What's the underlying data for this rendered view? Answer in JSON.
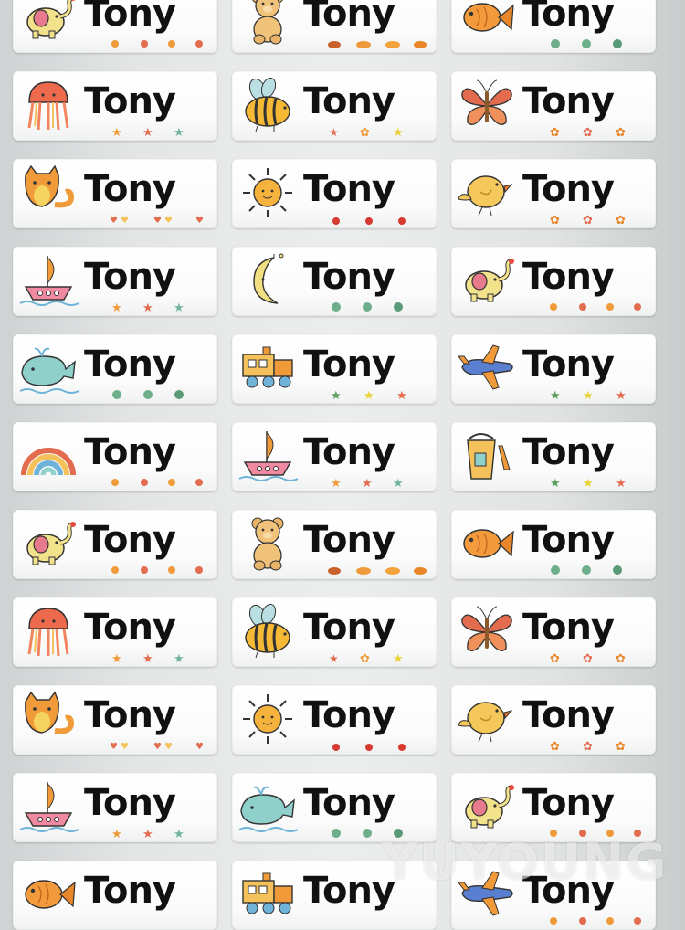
{
  "sheet": {
    "columns": 3,
    "labels": [
      {
        "name": "Tony",
        "icon": "elephant-icon",
        "decor": "dots"
      },
      {
        "name": "Tony",
        "icon": "teddy-bear-icon",
        "decor": "pastries"
      },
      {
        "name": "Tony",
        "icon": "goldfish-icon",
        "decor": "bubbles"
      },
      {
        "name": "Tony",
        "icon": "jellyfish-icon",
        "decor": "starfish"
      },
      {
        "name": "Tony",
        "icon": "bee-icon",
        "decor": "flowers-stars"
      },
      {
        "name": "Tony",
        "icon": "butterfly-icon",
        "decor": "flowers"
      },
      {
        "name": "Tony",
        "icon": "cat-icon",
        "decor": "hearts"
      },
      {
        "name": "Tony",
        "icon": "sun-icon",
        "decor": "cherries"
      },
      {
        "name": "Tony",
        "icon": "bird-icon",
        "decor": "flowers"
      },
      {
        "name": "Tony",
        "icon": "sailboat-icon",
        "decor": "starfish"
      },
      {
        "name": "Tony",
        "icon": "moon-icon",
        "decor": "bubbles"
      },
      {
        "name": "Tony",
        "icon": "elephant-icon",
        "decor": "dots"
      },
      {
        "name": "Tony",
        "icon": "whale-icon",
        "decor": "bubbles"
      },
      {
        "name": "Tony",
        "icon": "train-icon",
        "decor": "stars"
      },
      {
        "name": "Tony",
        "icon": "airplane-icon",
        "decor": "stars"
      },
      {
        "name": "Tony",
        "icon": "rainbow-icon",
        "decor": "dots"
      },
      {
        "name": "Tony",
        "icon": "sailboat-icon",
        "decor": "starfish"
      },
      {
        "name": "Tony",
        "icon": "sand-bucket-icon",
        "decor": "stars"
      },
      {
        "name": "Tony",
        "icon": "elephant-icon",
        "decor": "dots"
      },
      {
        "name": "Tony",
        "icon": "teddy-bear-icon",
        "decor": "pastries"
      },
      {
        "name": "Tony",
        "icon": "goldfish-icon",
        "decor": "bubbles"
      },
      {
        "name": "Tony",
        "icon": "jellyfish-icon",
        "decor": "starfish"
      },
      {
        "name": "Tony",
        "icon": "bee-icon",
        "decor": "flowers-stars"
      },
      {
        "name": "Tony",
        "icon": "butterfly-icon",
        "decor": "flowers"
      },
      {
        "name": "Tony",
        "icon": "cat-icon",
        "decor": "hearts"
      },
      {
        "name": "Tony",
        "icon": "sun-icon",
        "decor": "cherries"
      },
      {
        "name": "Tony",
        "icon": "bird-icon",
        "decor": "flowers"
      },
      {
        "name": "Tony",
        "icon": "sailboat-icon",
        "decor": "starfish"
      },
      {
        "name": "Tony",
        "icon": "whale-icon",
        "decor": "bubbles"
      },
      {
        "name": "Tony",
        "icon": "elephant-icon",
        "decor": "dots"
      },
      {
        "name": "Tony",
        "icon": "goldfish-icon",
        "decor": "none"
      },
      {
        "name": "Tony",
        "icon": "train-icon",
        "decor": "none"
      },
      {
        "name": "Tony",
        "icon": "airplane-icon",
        "decor": "dots"
      }
    ]
  },
  "watermark": {
    "text": "YUYOUNG"
  },
  "colors": {
    "label_bg": "#ffffff",
    "name_text": "#111111",
    "sheet_bg": "#e6e8e8"
  }
}
